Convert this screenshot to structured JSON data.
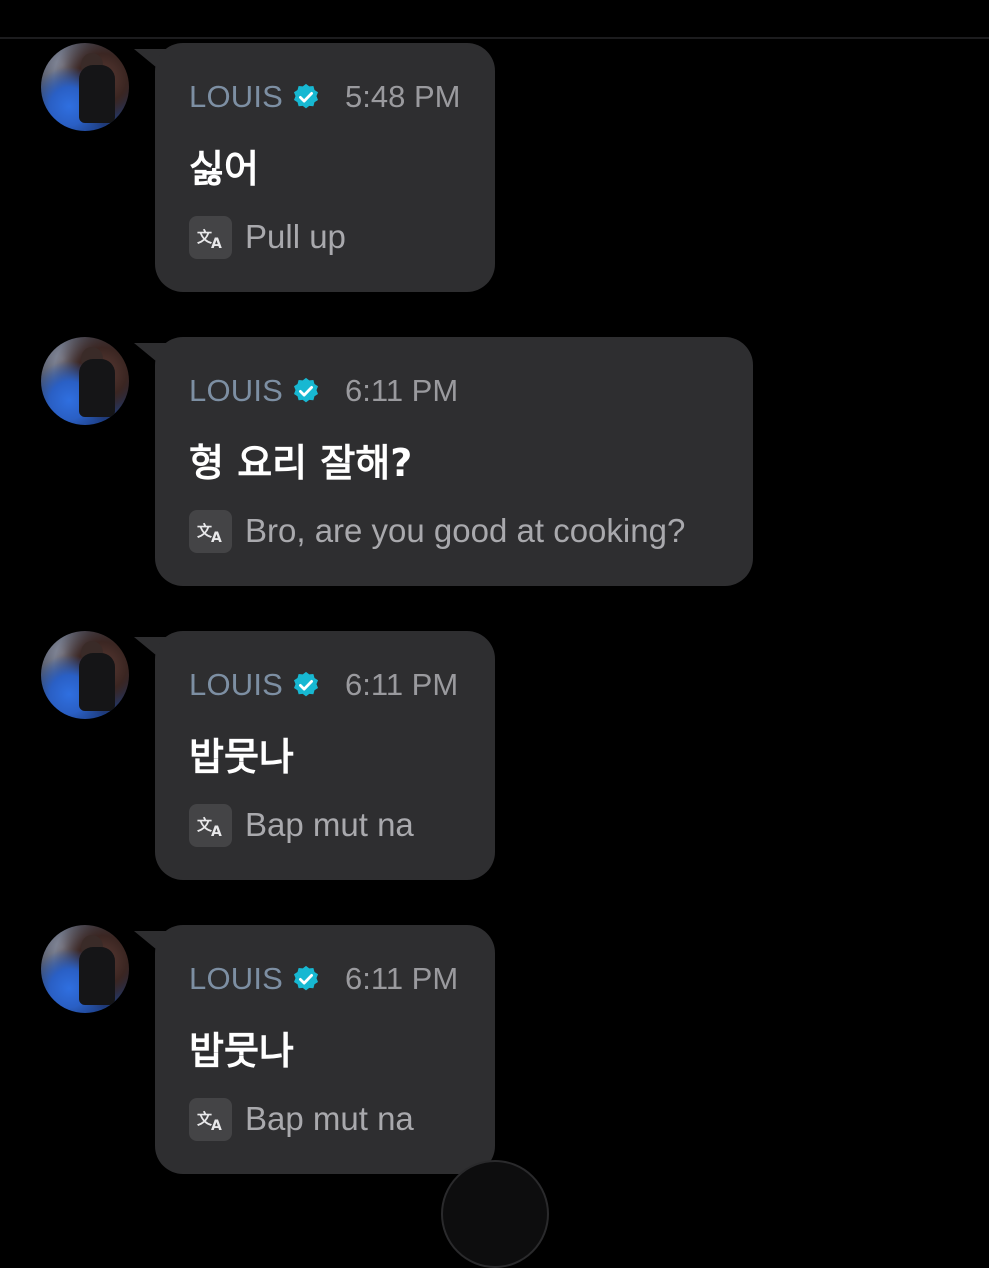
{
  "accent_colors": {
    "verified_badge": "#17b8d2",
    "author_name": "#7d8fa3",
    "bubble": "#2e2e30"
  },
  "messages": [
    {
      "author": "LOUIS",
      "time": "5:48 PM",
      "text": "싫어",
      "translation": "Pull up"
    },
    {
      "author": "LOUIS",
      "time": "6:11 PM",
      "text": "형 요리 잘해?",
      "translation": "Bro, are you good at cooking?"
    },
    {
      "author": "LOUIS",
      "time": "6:11 PM",
      "text": "밥뭇나",
      "translation": "Bap mut na"
    },
    {
      "author": "LOUIS",
      "time": "6:11 PM",
      "text": "밥뭇나",
      "translation": "Bap mut na"
    }
  ],
  "icons": {
    "verified": "verified-badge-icon",
    "translate": "translate-icon"
  }
}
